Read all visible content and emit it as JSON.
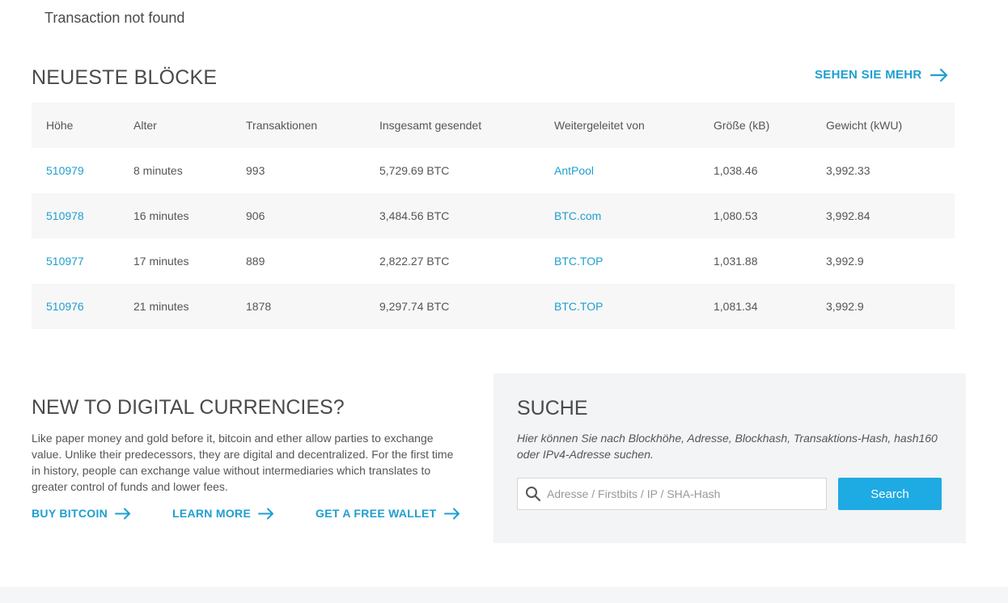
{
  "notice": "Transaction not found",
  "blocks": {
    "title": "NEUESTE BLÖCKE",
    "see_more": "SEHEN SIE MEHR",
    "columns": [
      "Höhe",
      "Alter",
      "Transaktionen",
      "Insgesamt gesendet",
      "Weitergeleitet von",
      "Größe (kB)",
      "Gewicht (kWU)"
    ],
    "rows": [
      {
        "height": "510979",
        "age": "8 minutes",
        "tx": "993",
        "sent": "5,729.69 BTC",
        "relayed": "AntPool",
        "size": "1,038.46",
        "weight": "3,992.33"
      },
      {
        "height": "510978",
        "age": "16 minutes",
        "tx": "906",
        "sent": "3,484.56 BTC",
        "relayed": "BTC.com",
        "size": "1,080.53",
        "weight": "3,992.84"
      },
      {
        "height": "510977",
        "age": "17 minutes",
        "tx": "889",
        "sent": "2,822.27 BTC",
        "relayed": "BTC.TOP",
        "size": "1,031.88",
        "weight": "3,992.9"
      },
      {
        "height": "510976",
        "age": "21 minutes",
        "tx": "1878",
        "sent": "9,297.74 BTC",
        "relayed": "BTC.TOP",
        "size": "1,081.34",
        "weight": "3,992.9"
      }
    ]
  },
  "intro": {
    "title": "NEW TO DIGITAL CURRENCIES?",
    "body": "Like paper money and gold before it, bitcoin and ether allow parties to exchange value. Unlike their predecessors, they are digital and decentralized. For the first time in history, people can exchange value without intermediaries which translates to greater control of funds and lower fees.",
    "buy": "BUY BITCOIN",
    "learn": "LEARN MORE",
    "wallet": "GET A FREE WALLET"
  },
  "search": {
    "title": "SUCHE",
    "description": "Hier können Sie nach Blockhöhe, Adresse, Blockhash, Transaktions-Hash, hash160 oder IPv4-Adresse suchen.",
    "placeholder": "Adresse / Firstbits / IP / SHA-Hash",
    "value": "",
    "button": "Search"
  },
  "colors": {
    "accent": "#1e9fd0",
    "button": "#1eaae2",
    "row_alt": "#f7f7f7",
    "panel": "#f2f4f6"
  },
  "icons": {
    "arrow": "arrow-right-icon",
    "search": "search-icon"
  }
}
